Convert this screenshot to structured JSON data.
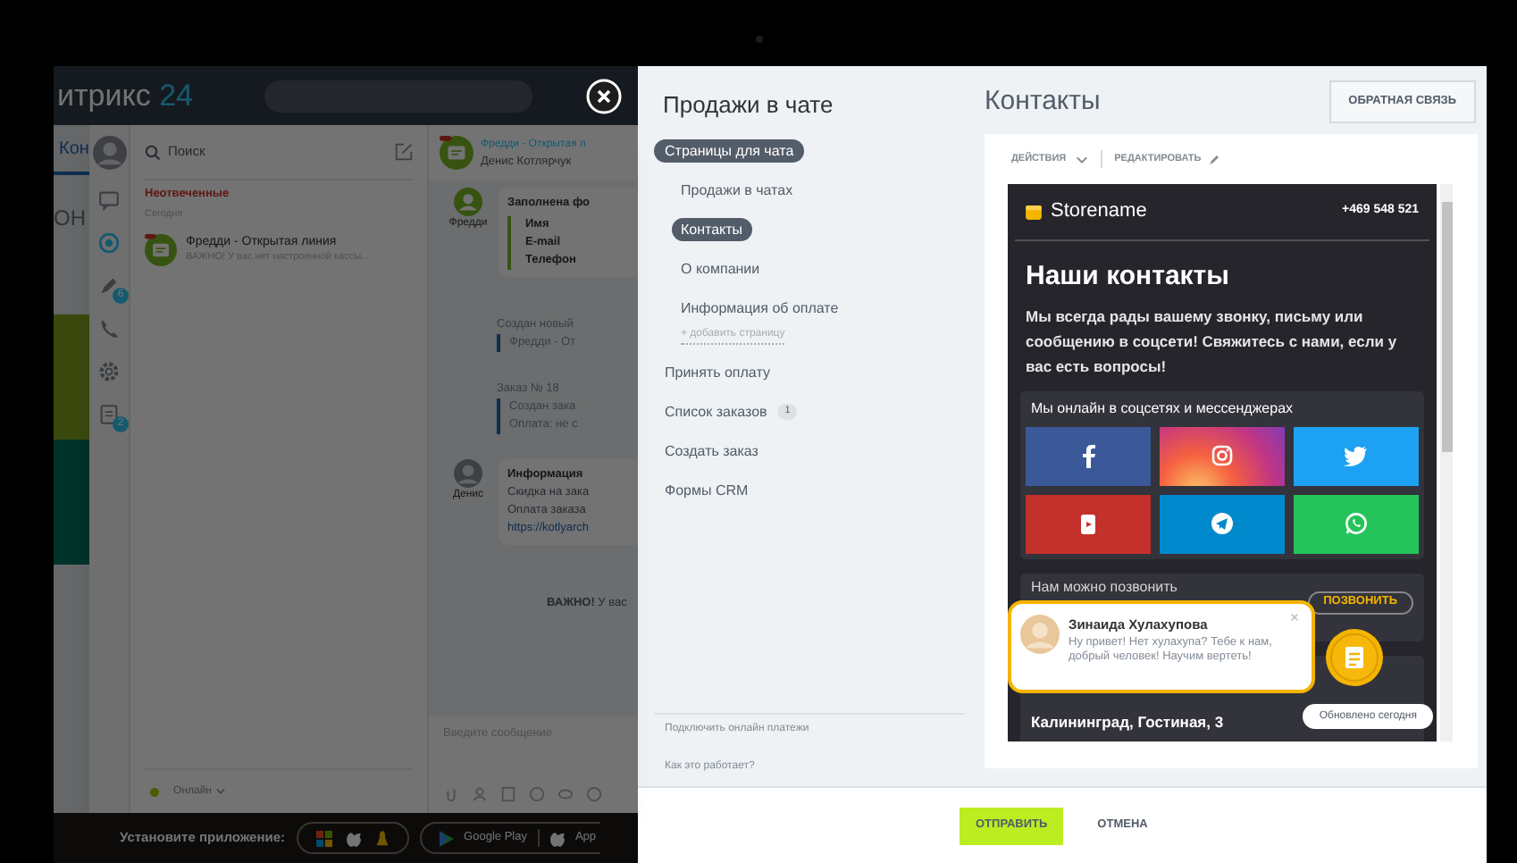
{
  "background_app": {
    "logo": {
      "name": "итрикс",
      "suffix": "24"
    },
    "page_fragments": [
      "Кон",
      "ОН"
    ],
    "messenger": {
      "rail": [
        {
          "kind": "chat",
          "selected": false
        },
        {
          "kind": "lines",
          "selected": true
        },
        {
          "kind": "pen",
          "selected": false,
          "count": "6"
        },
        {
          "kind": "phone",
          "selected": false
        },
        {
          "kind": "gear",
          "selected": false
        },
        {
          "kind": "notes",
          "selected": false,
          "count": "2"
        }
      ],
      "search_placeholder": "Поиск",
      "section": "Неотвеченные",
      "day": "Сегодня",
      "chats": [
        {
          "title": "Фредди - Открытая линия",
          "preview": "ВАЖНО! У вас нет настроенной кассы..."
        }
      ],
      "status": "Онлайн",
      "chat_header": {
        "title": "Фредди - Открытая л",
        "operator": "Денис Котлярчук"
      },
      "messages": [
        {
          "kind": "form",
          "author": "Фредди",
          "title": "Заполнена фо",
          "lines": [
            "Имя",
            "E-mail",
            "Телефон"
          ]
        },
        {
          "kind": "event",
          "title": "Создан новый",
          "lines": [
            "Фредди - От"
          ]
        },
        {
          "kind": "event",
          "title": "Заказ № 18",
          "lines": [
            "Создан зака",
            "Оплата: не с"
          ]
        },
        {
          "kind": "info",
          "author": "Денис",
          "title": "Информация",
          "lines": [
            "Скидка на зака",
            "Оплата заказа"
          ],
          "link": "https://kotlyarch"
        },
        {
          "kind": "notice",
          "text": "**ВАЖНО!** У вас"
        }
      ],
      "composer_placeholder": "Введите сообщение"
    },
    "install_bar": {
      "label": "Установите приложение:",
      "stores": [
        "Google Play",
        "App"
      ]
    }
  },
  "panel": {
    "title": "Продажи в чате",
    "nav": [
      {
        "kind": "group",
        "label": "Страницы для чата",
        "children": [
          {
            "label": "Продажи в чатах",
            "selected": false
          },
          {
            "label": "Контакты",
            "selected": true
          },
          {
            "label": "О компании",
            "selected": false
          },
          {
            "label": "Информация об оплате",
            "selected": false
          }
        ],
        "add_label": "+ добавить страницу"
      },
      {
        "kind": "link",
        "label": "Принять оплату"
      },
      {
        "kind": "link",
        "label": "Список заказов",
        "count": "1"
      },
      {
        "kind": "link",
        "label": "Создать заказ"
      },
      {
        "kind": "link",
        "label": "Формы CRM"
      }
    ],
    "footer_links": [
      "Подключить онлайн платежи",
      "Как это работает?"
    ],
    "page_title": "Контакты",
    "feedback_button": "ОБРАТНАЯ СВЯЗЬ",
    "toolbar": {
      "actions": "ДЕЙСТВИЯ",
      "edit": "РЕДАКТИРОВАТЬ"
    },
    "preview": {
      "store": "Storename",
      "phone": "+469 548 521",
      "heading": "Наши контакты",
      "intro": "Мы всегда рады вашему звонку, письму или сообщению в соцсети! Свяжитесь с нами, если у вас есть вопросы!",
      "social_title": "Мы онлайн в соцсетях и мессенджерах",
      "socials": [
        {
          "kind": "facebook",
          "color": "#3b5998"
        },
        {
          "kind": "instagram",
          "color": "#c13584"
        },
        {
          "kind": "twitter",
          "color": "#1da1f2"
        },
        {
          "kind": "youtube",
          "color": "#c4302b"
        },
        {
          "kind": "telegram",
          "color": "#0088cc"
        },
        {
          "kind": "whatsapp",
          "color": "#25c45a"
        }
      ],
      "call_title": "Нам можно позвонить",
      "call_button": "ПОЗВОНИТЬ",
      "address": "Калининград, Гостиная, 3",
      "chat_popup": {
        "name": "Зинаида Хулахупова",
        "message": "Ну привет! Нет хулахупа? Тебе к нам, добрый человек! Научим вертеть!"
      },
      "updated": "Обновлено сегодня"
    },
    "buttons": {
      "send": "ОТПРАВИТЬ",
      "cancel": "ОТМЕНА"
    }
  }
}
